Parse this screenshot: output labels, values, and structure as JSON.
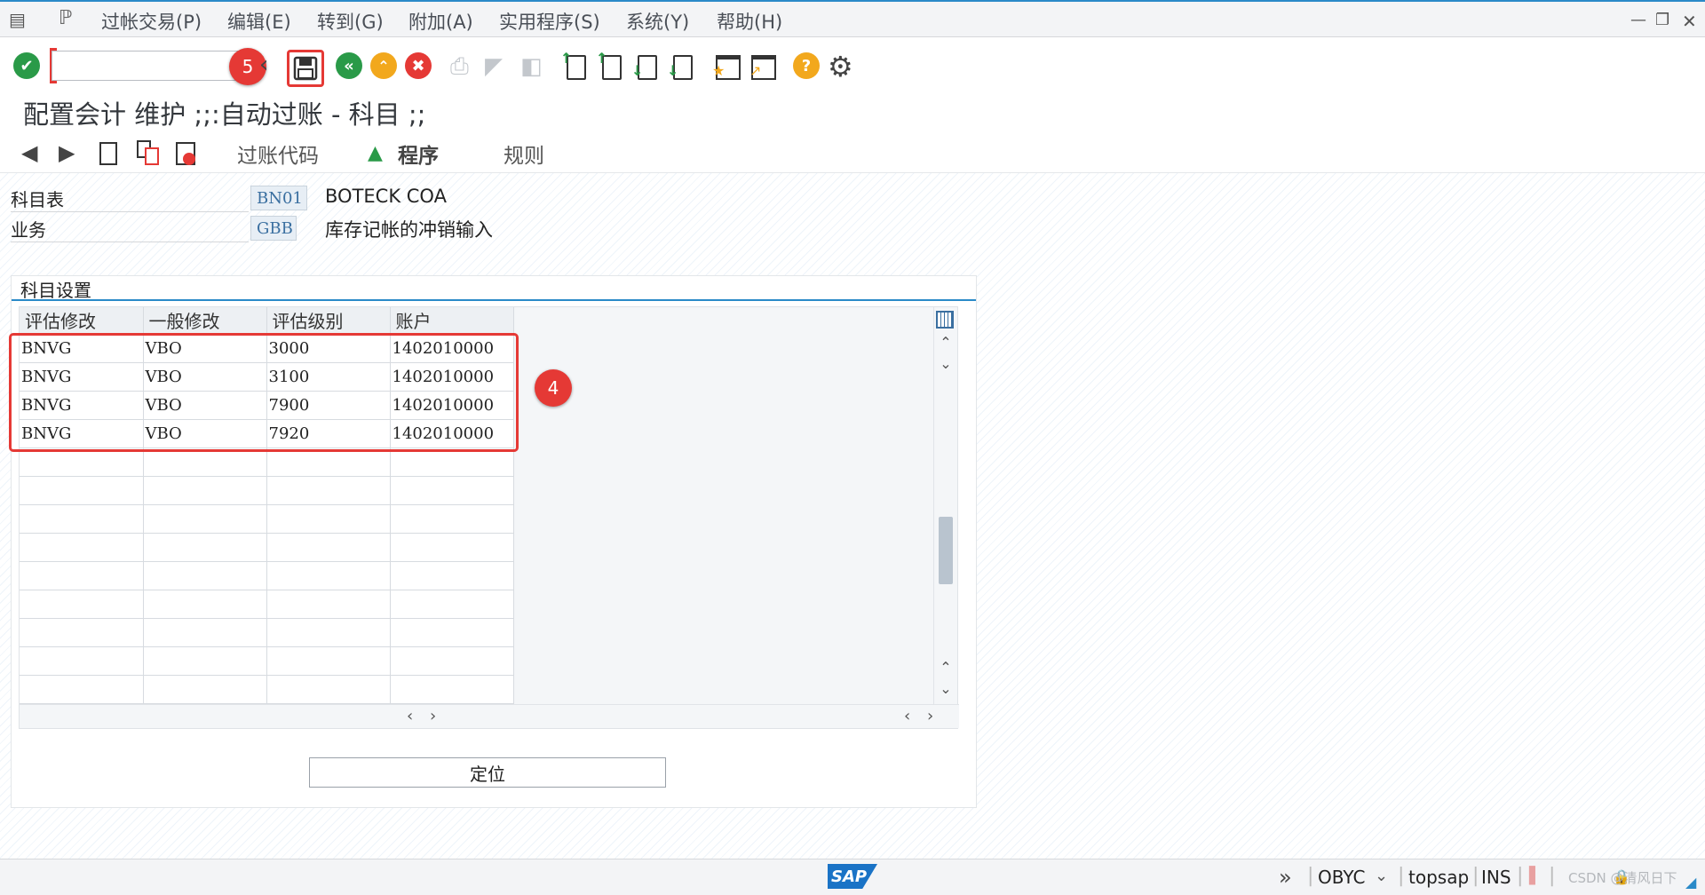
{
  "menu": {
    "items": [
      "过帐交易(P)",
      "编辑(E)",
      "转到(G)",
      "附加(A)",
      "实用程序(S)",
      "系统(Y)",
      "帮助(H)"
    ]
  },
  "toolbar": {
    "command_field": "",
    "badge_save": "5"
  },
  "page": {
    "title": "配置会计 维护 ;;:自动过账 - 科目 ;;"
  },
  "app_toolbar": {
    "posting_code": "过账代码",
    "procedure": "程序",
    "rules": "规则"
  },
  "fields": {
    "chart_label": "科目表",
    "chart_value": "BN01",
    "chart_desc": "BOTECK COA",
    "business_label": "业务",
    "business_value": "GBB",
    "business_desc": "库存记帐的冲销输入"
  },
  "group": {
    "title": "科目设置",
    "columns": [
      "评估修改",
      "一般修改",
      "评估级别",
      "账户"
    ],
    "rows": [
      [
        "BNVG",
        "VBO",
        "3000",
        "1402010000"
      ],
      [
        "BNVG",
        "VBO",
        "3100",
        "1402010000"
      ],
      [
        "BNVG",
        "VBO",
        "7900",
        "1402010000"
      ],
      [
        "BNVG",
        "VBO",
        "7920",
        "1402010000"
      ]
    ],
    "badge_rows": "4",
    "locate_button": "定位"
  },
  "status": {
    "transaction": "OBYC",
    "server": "topsap",
    "mode": "INS",
    "watermark": "CSDN @清风日下"
  },
  "colors": {
    "accent": "#2a8ac8",
    "highlight_red": "#e53935",
    "ok_green": "#2a9a48",
    "warn_orange": "#f2a81d"
  }
}
